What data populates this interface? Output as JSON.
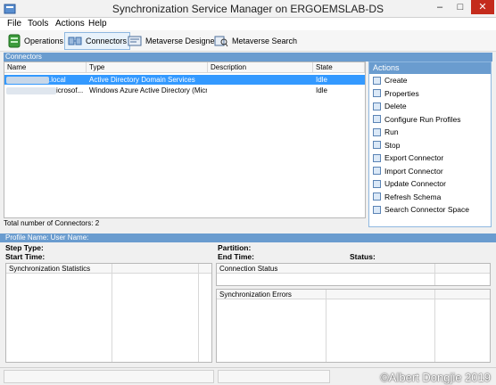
{
  "window": {
    "title": "Synchronization Service Manager on ERGOEMSLAB-DS",
    "controls": [
      "–",
      "□",
      "✕"
    ]
  },
  "menu": [
    "File",
    "Tools",
    "Actions",
    "Help"
  ],
  "toolbar": [
    {
      "label": "Operations",
      "icon": "operations-icon"
    },
    {
      "label": "Connectors",
      "icon": "connectors-icon",
      "active": true
    },
    {
      "label": "Metaverse Designer",
      "icon": "metaverse-designer-icon"
    },
    {
      "label": "Metaverse Search",
      "icon": "metaverse-search-icon"
    }
  ],
  "connectors": {
    "section_label": "Connectors",
    "columns": [
      "Name",
      "Type",
      "Description",
      "State"
    ],
    "rows": [
      {
        "name": ".local",
        "type": "Active Directory Domain Services",
        "description": "",
        "state": "Idle",
        "selected": true
      },
      {
        "name": "icrosof...",
        "type": "Windows Azure Active Directory (Micr...",
        "description": "",
        "state": "Idle",
        "selected": false
      }
    ],
    "total_label": "Total number of Connectors: 2"
  },
  "actions": {
    "header": "Actions",
    "items": [
      "Create",
      "Properties",
      "Delete",
      "Configure Run Profiles",
      "Run",
      "Stop",
      "Export Connector",
      "Import Connector",
      "Update Connector",
      "Refresh Schema",
      "Search Connector Space"
    ]
  },
  "profile": {
    "header": "Profile Name:   User Name:",
    "step_type": "Step Type:",
    "start_time": "Start Time:",
    "partition": "Partition:",
    "end_time": "End Time:",
    "status": "Status:",
    "sync_stats": "Synchronization Statistics",
    "connection_status": "Connection Status",
    "sync_errors": "Synchronization Errors"
  },
  "watermark": "©Albert Dongjie  2019"
}
